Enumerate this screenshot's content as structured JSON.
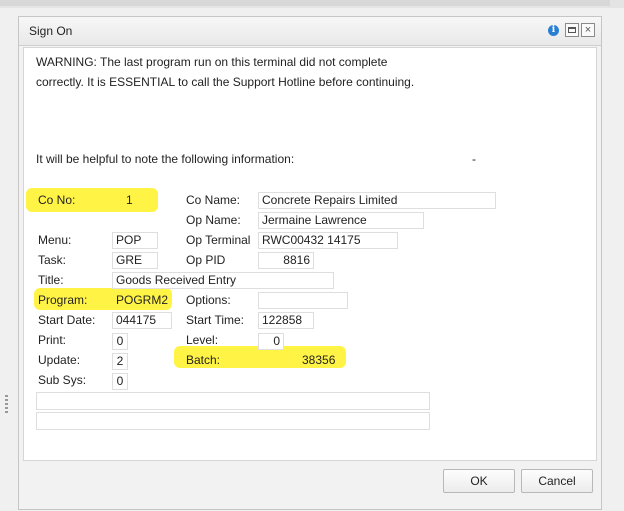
{
  "window": {
    "title": "Sign On"
  },
  "message": {
    "warning": "WARNING:    The last program run on this terminal did not complete correctly. It is ESSENTIAL to call the Support Hotline before continuing.",
    "helpful": "It will be helpful to note the following information:",
    "dash": "-"
  },
  "fields": {
    "co_no": {
      "label": "Co No:",
      "value": "1"
    },
    "menu": {
      "label": "Menu:",
      "value": "POP"
    },
    "task": {
      "label": "Task:",
      "value": "GRE"
    },
    "title": {
      "label": "Title:",
      "value": "Goods Received Entry"
    },
    "program": {
      "label": "Program:",
      "value": "POGRM2"
    },
    "start_date": {
      "label": "Start Date:",
      "value": "044175"
    },
    "print": {
      "label": "Print:",
      "value": "0"
    },
    "update": {
      "label": "Update:",
      "value": "2"
    },
    "sub_sys": {
      "label": "Sub Sys:",
      "value": "0"
    },
    "co_name": {
      "label": "Co Name:",
      "value": "Concrete Repairs Limited"
    },
    "op_name": {
      "label": "Op Name:",
      "value": "Jermaine Lawrence"
    },
    "op_terminal": {
      "label": "Op Terminal",
      "value": "RWC00432   14175"
    },
    "op_pid": {
      "label": "Op PID",
      "value": "8816"
    },
    "options": {
      "label": "Options:",
      "value": ""
    },
    "start_time": {
      "label": "Start Time:",
      "value": "122858"
    },
    "level": {
      "label": "Level:",
      "value": "0"
    },
    "batch": {
      "label": "Batch:",
      "value": "38356"
    }
  },
  "buttons": {
    "ok": "OK",
    "cancel": "Cancel"
  },
  "colors": {
    "highlight": "#fff33b",
    "info": "#2b7fd3"
  }
}
